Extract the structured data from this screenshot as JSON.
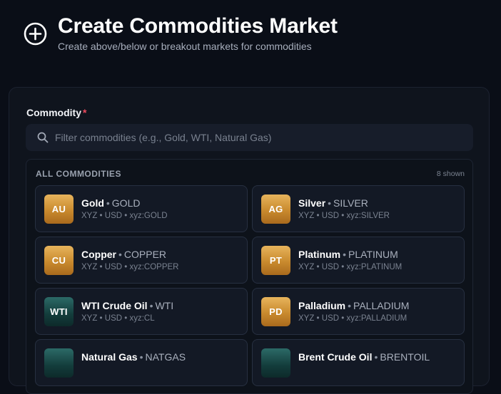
{
  "header": {
    "title": "Create Commodities Market",
    "subtitle": "Create above/below or breakout markets for commodities"
  },
  "form": {
    "commodity_label": "Commodity",
    "required_mark": "*",
    "search": {
      "placeholder": "Filter commodities (e.g., Gold, WTI, Natural Gas)",
      "value": ""
    }
  },
  "list": {
    "title": "ALL COMMODITIES",
    "count": "8 shown",
    "items": [
      {
        "badge": "AU",
        "badge_style": "gold",
        "name": "Gold",
        "sep": "•",
        "code": "GOLD",
        "meta": "XYZ • USD • xyz:GOLD"
      },
      {
        "badge": "AG",
        "badge_style": "gold",
        "name": "Silver",
        "sep": "•",
        "code": "SILVER",
        "meta": "XYZ • USD • xyz:SILVER"
      },
      {
        "badge": "CU",
        "badge_style": "gold",
        "name": "Copper",
        "sep": "•",
        "code": "COPPER",
        "meta": "XYZ • USD • xyz:COPPER"
      },
      {
        "badge": "PT",
        "badge_style": "gold",
        "name": "Platinum",
        "sep": "•",
        "code": "PLATINUM",
        "meta": "XYZ • USD • xyz:PLATINUM"
      },
      {
        "badge": "WTI",
        "badge_style": "teal",
        "name": "WTI Crude Oil",
        "sep": "•",
        "code": "WTI",
        "meta": "XYZ • USD • xyz:CL"
      },
      {
        "badge": "PD",
        "badge_style": "gold",
        "name": "Palladium",
        "sep": "•",
        "code": "PALLADIUM",
        "meta": "XYZ • USD • xyz:PALLADIUM"
      },
      {
        "badge": "",
        "badge_style": "teal",
        "name": "Natural Gas",
        "sep": "•",
        "code": "NATGAS",
        "meta": ""
      },
      {
        "badge": "",
        "badge_style": "teal",
        "name": "Brent Crude Oil",
        "sep": "•",
        "code": "BRENTOIL",
        "meta": ""
      }
    ]
  },
  "colors": {
    "background": "#0a0e17",
    "panel": "#0f141d",
    "required": "#ef4b5e",
    "badge_gold": "#c98a2e",
    "badge_teal": "#1f4f4d"
  },
  "icons": {
    "header": "plus-circle-icon",
    "search": "search-icon"
  }
}
